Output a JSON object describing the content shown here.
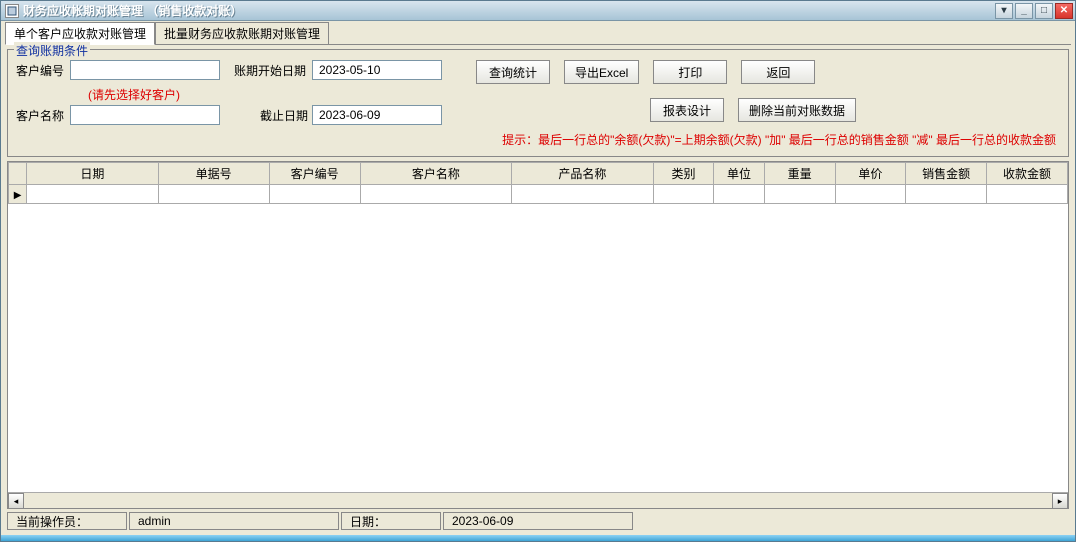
{
  "window": {
    "title": "财务应收帐期对账管理 （销售收款对账）"
  },
  "tabs": {
    "active": "单个客户应收款对账管理",
    "inactive": "批量财务应收款账期对账管理"
  },
  "fieldset": {
    "legend": "查询账期条件",
    "labels": {
      "customer_no": "客户编号",
      "customer_name": "客户名称",
      "period_start": "账期开始日期",
      "period_end": "截止日期"
    },
    "values": {
      "customer_no": "",
      "customer_name": "",
      "period_start": "2023-05-10",
      "period_end": "2023-06-09"
    },
    "please_select": "(请先选择好客户)"
  },
  "buttons": {
    "query": "查询统计",
    "export": "导出Excel",
    "print": "打印",
    "back": "返回",
    "report": "报表设计",
    "delete": "删除当前对账数据"
  },
  "hint": "提示：最后一行总的\"余额(欠款)\"=上期余额(欠款) \"加\" 最后一行总的销售金额 \"减\" 最后一行总的收款金额",
  "grid": {
    "headers": [
      "日期",
      "单据号",
      "客户编号",
      "客户名称",
      "产品名称",
      "类别",
      "单位",
      "重量",
      "单价",
      "销售金额",
      "收款金额"
    ]
  },
  "status": {
    "operator_label": "当前操作员：",
    "operator_value": "admin",
    "date_label": "日期：",
    "date_value": "2023-06-09"
  }
}
